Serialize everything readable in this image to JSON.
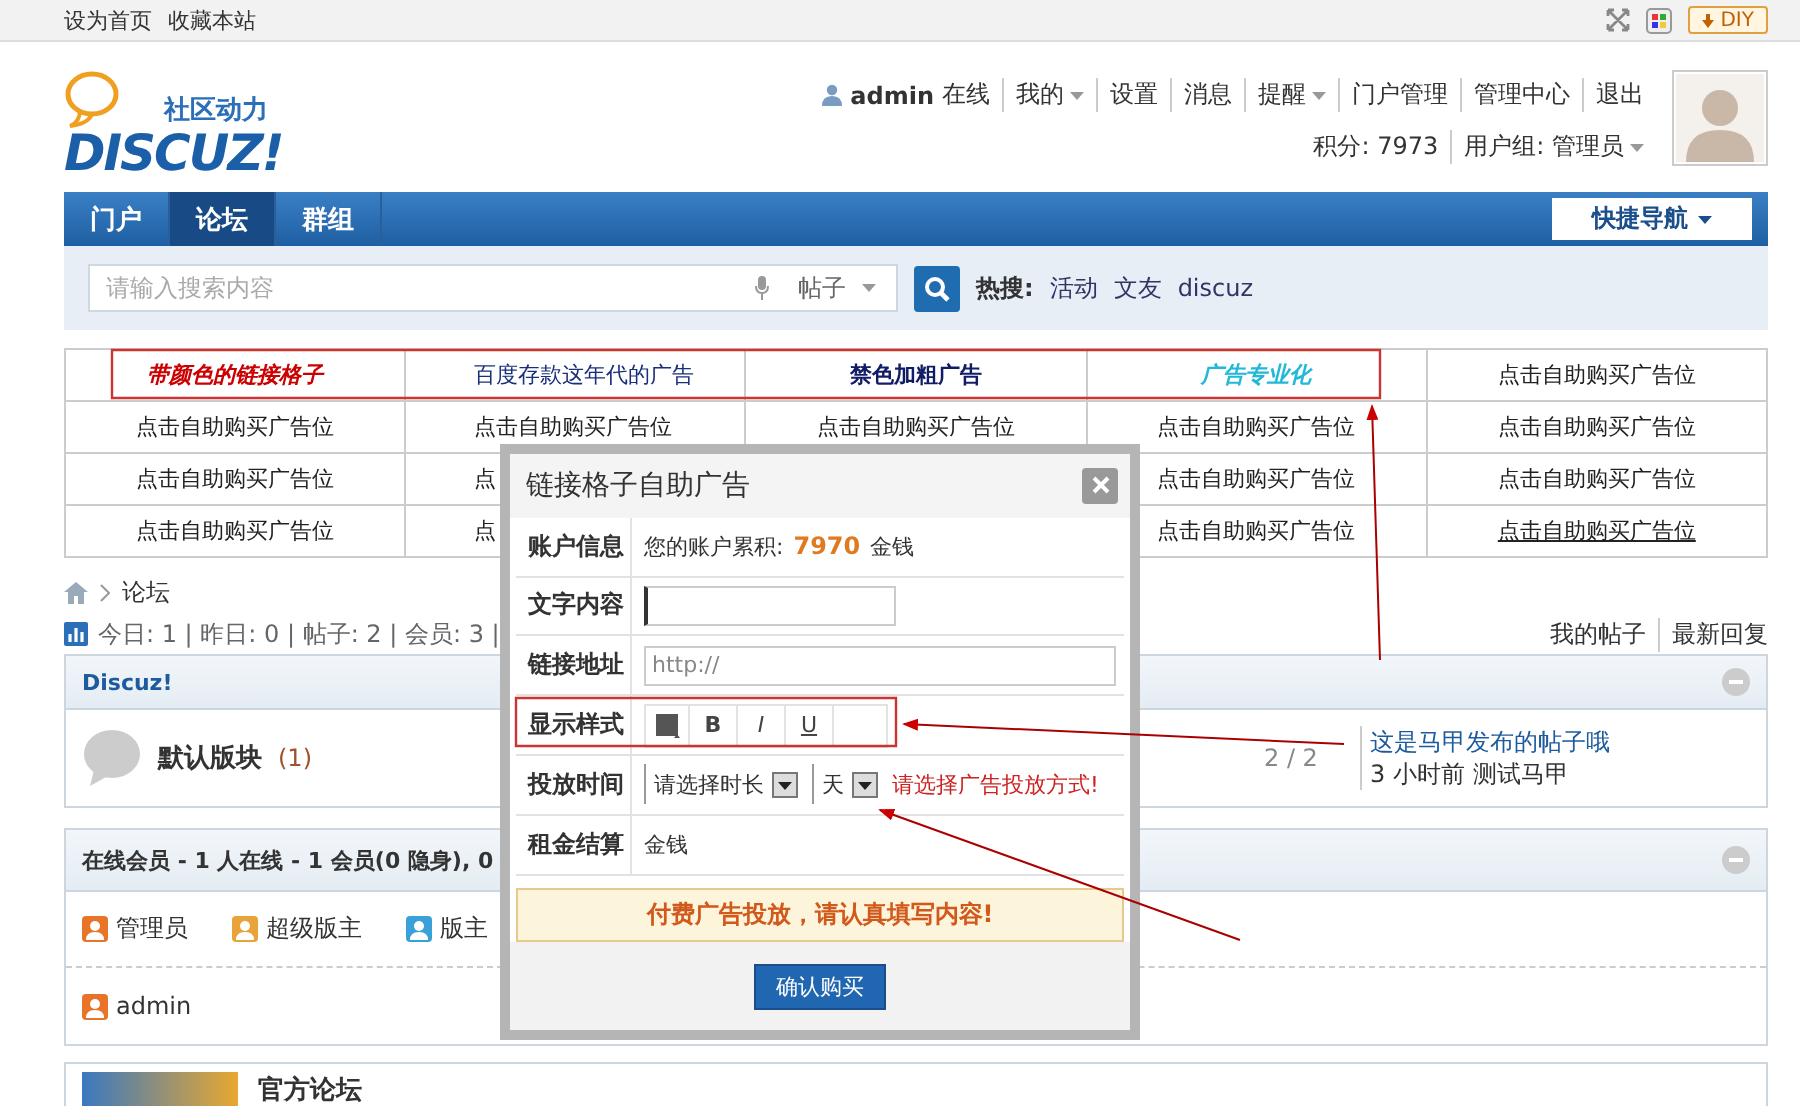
{
  "top_bar": {
    "links": [
      "设为首页",
      "收藏本站"
    ],
    "diy_button": "DIY"
  },
  "header": {
    "logo": {
      "tagline": "社区动力",
      "wordmark": "DISCUZ!"
    },
    "user": {
      "name": "admin",
      "status": "在线"
    },
    "user_menu": [
      {
        "label": "我的",
        "dropdown": true
      },
      {
        "label": "设置",
        "dropdown": false
      },
      {
        "label": "消息",
        "dropdown": false
      },
      {
        "label": "提醒",
        "dropdown": true
      },
      {
        "label": "门户管理",
        "dropdown": false
      },
      {
        "label": "管理中心",
        "dropdown": false
      },
      {
        "label": "退出",
        "dropdown": false
      }
    ],
    "credits": "积分: 7973",
    "group": "用户组: 管理员"
  },
  "nav": {
    "tabs": [
      {
        "label": "门户",
        "selected": false
      },
      {
        "label": "论坛",
        "selected": true
      },
      {
        "label": "群组",
        "selected": false
      }
    ],
    "quick_nav": "快捷导航"
  },
  "search": {
    "placeholder": "请输入搜索内容",
    "scope": "帖子",
    "hot_label": "热搜:",
    "hot_terms": [
      "活动",
      "文友",
      "discuz"
    ]
  },
  "ad_grid": {
    "rows": [
      [
        {
          "text": "带颜色的链接格子",
          "color": "#cc0000",
          "bold": true,
          "italic": true
        },
        {
          "text": "百度存款这年代的广告",
          "color": "#1a2f7a",
          "bold": false,
          "italic": false
        },
        {
          "text": "禁色加粗广告",
          "color": "#111c66",
          "bold": true,
          "italic": false
        },
        {
          "text": "广告专业化",
          "color": "#22b8d8",
          "bold": true,
          "italic": true
        },
        {
          "text": "点击自助购买广告位"
        }
      ],
      [
        {
          "text": "点击自助购买广告位"
        },
        {
          "text": "点击自助购买广告位"
        },
        {
          "text": "点击自助购买广告位"
        },
        {
          "text": "点击自助购买广告位"
        },
        {
          "text": "点击自助购买广告位"
        }
      ],
      [
        {
          "text": "点击自助购买广告位"
        },
        {
          "text": "点"
        },
        null,
        {
          "text": "点击自助购买广告位"
        },
        {
          "text": "点击自助购买广告位"
        }
      ],
      [
        {
          "text": "点击自助购买广告位"
        },
        {
          "text": "点"
        },
        null,
        {
          "text": "点击自助购买广告位"
        },
        {
          "text": "点击自助购买广告位",
          "underline": true
        }
      ]
    ]
  },
  "breadcrumb": [
    "论坛"
  ],
  "stats": "今日: 1 | 昨日: 0 | 帖子: 2 | 会员: 3 |",
  "quick_links": [
    "我的帖子",
    "最新回复"
  ],
  "forum_category": {
    "title": "Discuz!",
    "forums": [
      {
        "name": "默认版块",
        "count": "(1)",
        "stats": "2 / 2",
        "last_post": "这是马甲发布的帖子哦",
        "last_post_meta": "3 小时前 测试马甲"
      }
    ]
  },
  "online": {
    "title": "在线会员 - 1 人在线 - 1 会员(0 隐身), 0",
    "legend": [
      {
        "label": "管理员",
        "color": "#e8742a"
      },
      {
        "label": "超级版主",
        "color": "#e8a33a"
      },
      {
        "label": "版主",
        "color": "#3aa0d8"
      }
    ],
    "members": [
      {
        "name": "admin",
        "color": "#e8742a"
      }
    ]
  },
  "partner": {
    "title": "官方论坛"
  },
  "modal": {
    "title": "链接格子自助广告",
    "rows": [
      {
        "kind": "info",
        "label": "账户信息",
        "prefix": "您的账户累积:",
        "amount": "7970",
        "unit": "金钱"
      },
      {
        "kind": "input",
        "label": "文字内容",
        "focused": true
      },
      {
        "kind": "input",
        "label": "链接地址",
        "value": "http://",
        "focused": false
      },
      {
        "kind": "style",
        "label": "显示样式",
        "buttons": [
          {
            "label": "B",
            "kind": "bold"
          },
          {
            "label": "I",
            "kind": "italic"
          },
          {
            "label": "U",
            "kind": "underline"
          }
        ]
      },
      {
        "kind": "time",
        "label": "投放时间",
        "duration": "请选择时长",
        "unit": "天",
        "warning": "请选择广告投放方式!"
      },
      {
        "kind": "text",
        "label": "租金结算",
        "value": "金钱"
      }
    ],
    "notice": "付费广告投放，请认真填写内容!",
    "confirm": "确认购买"
  }
}
